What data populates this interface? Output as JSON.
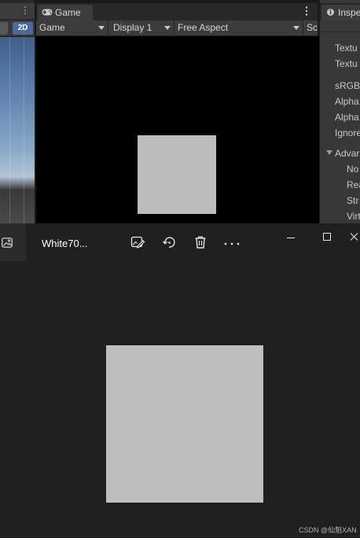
{
  "scene": {
    "mode_button": "2D",
    "menu_glyph": "⋮"
  },
  "game_view": {
    "tab_label": "Game",
    "tab_icon": "gamepad-icon",
    "menu_icon": "vertical-ellipsis-icon",
    "toolbar": {
      "view_dropdown": "Game",
      "display_dropdown": "Display 1",
      "aspect_dropdown": "Free Aspect",
      "scale_dropdown": "Sc"
    },
    "background_color": "#000000",
    "sprite_color": "#bcbcbc"
  },
  "inspector": {
    "tab_label": "Inspe",
    "tab_icon": "info-icon",
    "rows": [
      "Textu",
      "Textu",
      "sRGB",
      "Alpha",
      "Alpha",
      "Ignore"
    ],
    "advanced": {
      "label": "Advar",
      "items": [
        "No",
        "Rea",
        "Str",
        "Virt"
      ]
    }
  },
  "photos_viewer": {
    "app_icon": "image-icon",
    "file_name": "White70...",
    "toolbar": {
      "edit_icon": "edit-image-icon",
      "rotate_icon": "rotate-icon",
      "delete_icon": "delete-icon",
      "more_label": "···"
    },
    "window_controls": {
      "minimize": "minimize-icon",
      "maximize": "maximize-icon",
      "close": "close-icon"
    },
    "background_color": "#202020",
    "image_color": "#bebebe"
  },
  "watermark": "CSDN @仙魁XAN"
}
